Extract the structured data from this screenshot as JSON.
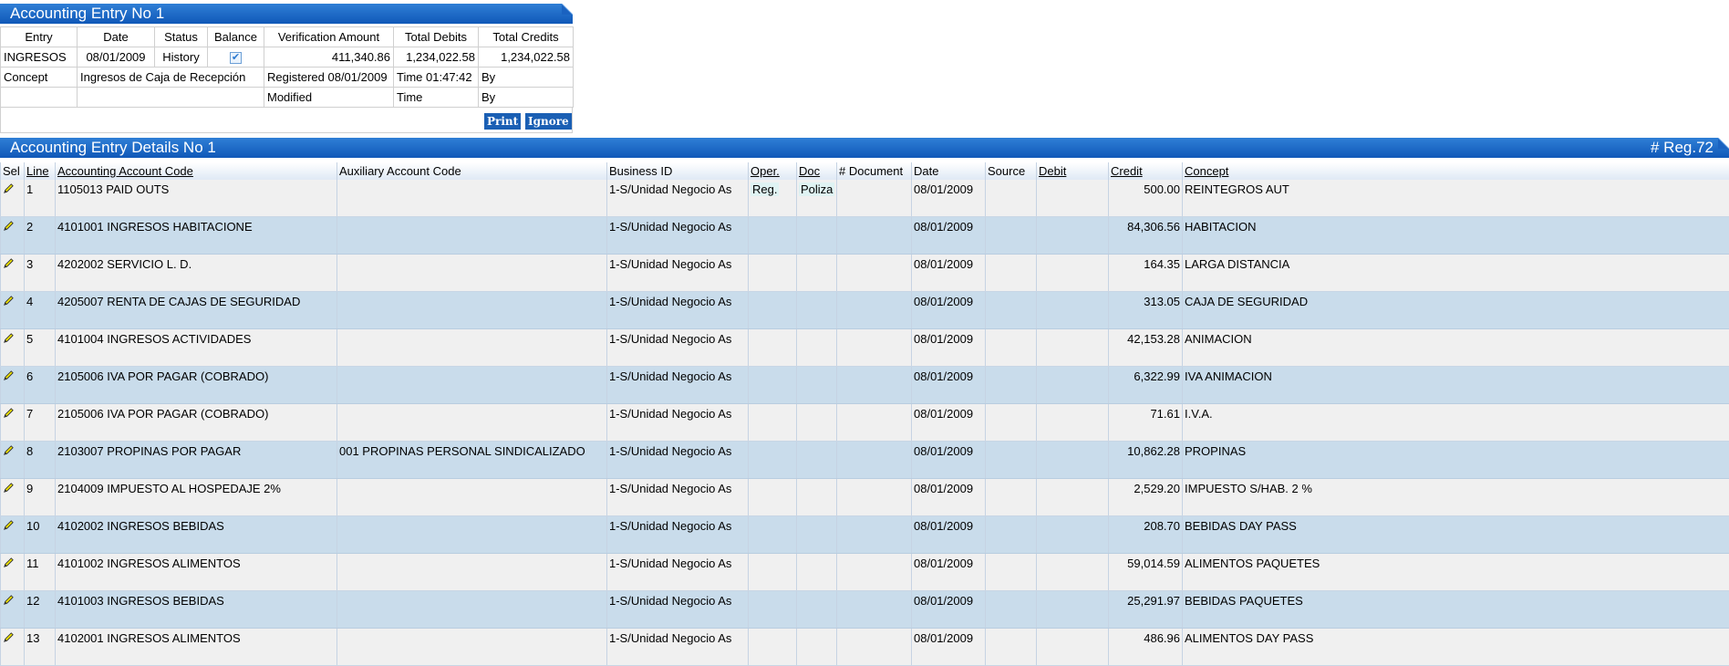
{
  "entry_panel": {
    "title": "Accounting Entry No 1",
    "headers": [
      "Entry",
      "Date",
      "Status",
      "Balance",
      "Verification Amount",
      "Total Debits",
      "Total Credits"
    ],
    "entry": "INGRESOS",
    "date": "08/01/2009",
    "status": "History",
    "verification_amount": "411,340.86",
    "total_debits": "1,234,022.58",
    "total_credits": "1,234,022.58",
    "concept_label": "Concept",
    "concept_value": "Ingresos de Caja de Recepción",
    "registered": "Registered 08/01/2009",
    "time1": "Time  01:47:42",
    "by1": "By",
    "modified": "Modified",
    "time2": "Time",
    "by2": "By",
    "print_label": "Print",
    "ignore_label": "Ignore"
  },
  "details_panel": {
    "title": "Accounting Entry Details No 1",
    "reg_count": "# Reg.72",
    "columns": [
      "Sel",
      "Line",
      "Accounting Account Code",
      "Auxiliary Account Code",
      "Business ID",
      "Oper.",
      "Doc",
      "# Document",
      "Date",
      "Source",
      "Debit",
      "Credit",
      "Concept"
    ],
    "rows": [
      {
        "line": "1",
        "account": "1105013 PAID OUTS",
        "aux": "",
        "business": "1-S/Unidad Negocio As",
        "oper": "Reg.",
        "doc": "Poliza",
        "document": "",
        "date": "08/01/2009",
        "source": "",
        "debit": "",
        "credit": "500.00",
        "concept": "REINTEGROS AUT"
      },
      {
        "line": "2",
        "account": "4101001 INGRESOS HABITACIONE",
        "aux": "",
        "business": "1-S/Unidad Negocio As",
        "oper": "",
        "doc": "",
        "document": "",
        "date": "08/01/2009",
        "source": "",
        "debit": "",
        "credit": "84,306.56",
        "concept": "HABITACION"
      },
      {
        "line": "3",
        "account": "4202002 SERVICIO L. D.",
        "aux": "",
        "business": "1-S/Unidad Negocio As",
        "oper": "",
        "doc": "",
        "document": "",
        "date": "08/01/2009",
        "source": "",
        "debit": "",
        "credit": "164.35",
        "concept": "LARGA DISTANCIA"
      },
      {
        "line": "4",
        "account": "4205007 RENTA DE CAJAS DE SEGURIDAD",
        "aux": "",
        "business": "1-S/Unidad Negocio As",
        "oper": "",
        "doc": "",
        "document": "",
        "date": "08/01/2009",
        "source": "",
        "debit": "",
        "credit": "313.05",
        "concept": "CAJA DE SEGURIDAD"
      },
      {
        "line": "5",
        "account": "4101004 INGRESOS ACTIVIDADES",
        "aux": "",
        "business": "1-S/Unidad Negocio As",
        "oper": "",
        "doc": "",
        "document": "",
        "date": "08/01/2009",
        "source": "",
        "debit": "",
        "credit": "42,153.28",
        "concept": "ANIMACION"
      },
      {
        "line": "6",
        "account": "2105006 IVA POR PAGAR (COBRADO)",
        "aux": "",
        "business": "1-S/Unidad Negocio As",
        "oper": "",
        "doc": "",
        "document": "",
        "date": "08/01/2009",
        "source": "",
        "debit": "",
        "credit": "6,322.99",
        "concept": "IVA ANIMACION"
      },
      {
        "line": "7",
        "account": "2105006 IVA POR PAGAR (COBRADO)",
        "aux": "",
        "business": "1-S/Unidad Negocio As",
        "oper": "",
        "doc": "",
        "document": "",
        "date": "08/01/2009",
        "source": "",
        "debit": "",
        "credit": "71.61",
        "concept": "I.V.A."
      },
      {
        "line": "8",
        "account": "2103007 PROPINAS POR PAGAR",
        "aux": "001 PROPINAS PERSONAL SINDICALIZADO",
        "business": "1-S/Unidad Negocio As",
        "oper": "",
        "doc": "",
        "document": "",
        "date": "08/01/2009",
        "source": "",
        "debit": "",
        "credit": "10,862.28",
        "concept": "PROPINAS"
      },
      {
        "line": "9",
        "account": "2104009 IMPUESTO AL HOSPEDAJE 2%",
        "aux": "",
        "business": "1-S/Unidad Negocio As",
        "oper": "",
        "doc": "",
        "document": "",
        "date": "08/01/2009",
        "source": "",
        "debit": "",
        "credit": "2,529.20",
        "concept": "IMPUESTO S/HAB. 2 %"
      },
      {
        "line": "10",
        "account": "4102002 INGRESOS BEBIDAS",
        "aux": "",
        "business": "1-S/Unidad Negocio As",
        "oper": "",
        "doc": "",
        "document": "",
        "date": "08/01/2009",
        "source": "",
        "debit": "",
        "credit": "208.70",
        "concept": "BEBIDAS DAY PASS"
      },
      {
        "line": "11",
        "account": "4101002 INGRESOS ALIMENTOS",
        "aux": "",
        "business": "1-S/Unidad Negocio As",
        "oper": "",
        "doc": "",
        "document": "",
        "date": "08/01/2009",
        "source": "",
        "debit": "",
        "credit": "59,014.59",
        "concept": "ALIMENTOS PAQUETES"
      },
      {
        "line": "12",
        "account": "4101003 INGRESOS BEBIDAS",
        "aux": "",
        "business": "1-S/Unidad Negocio As",
        "oper": "",
        "doc": "",
        "document": "",
        "date": "08/01/2009",
        "source": "",
        "debit": "",
        "credit": "25,291.97",
        "concept": "BEBIDAS PAQUETES"
      },
      {
        "line": "13",
        "account": "4102001 INGRESOS ALIMENTOS",
        "aux": "",
        "business": "1-S/Unidad Negocio As",
        "oper": "",
        "doc": "",
        "document": "",
        "date": "08/01/2009",
        "source": "",
        "debit": "",
        "credit": "486.96",
        "concept": "ALIMENTOS DAY PASS"
      }
    ]
  }
}
